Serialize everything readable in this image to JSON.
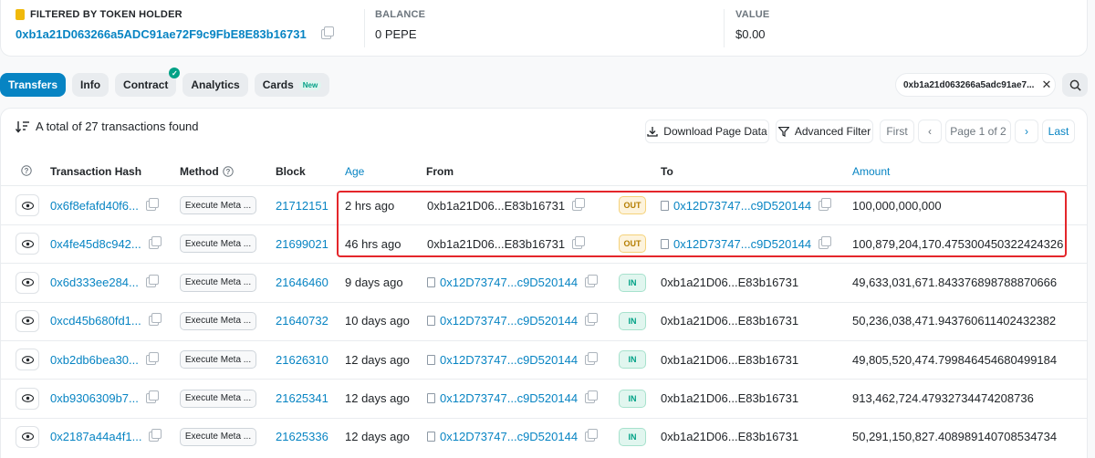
{
  "summary": {
    "holder_label": "FILTERED BY TOKEN HOLDER",
    "holder_address": "0xb1a21D063266a5ADC91ae72F9c9FbE8E83b16731",
    "balance_label": "BALANCE",
    "balance_value": "0 PEPE",
    "value_label": "VALUE",
    "value_value": "$0.00"
  },
  "tabs": [
    {
      "label": "Transfers",
      "active": true
    },
    {
      "label": "Info"
    },
    {
      "label": "Contract",
      "verified": true
    },
    {
      "label": "Analytics"
    },
    {
      "label": "Cards",
      "badge": "New"
    }
  ],
  "filter_chip": "0xb1a21d063266a5adc91ae7...",
  "table": {
    "total_text": "A total of 27 transactions found",
    "download_label": "Download Page Data",
    "advanced_filter_label": "Advanced Filter",
    "first_label": "First",
    "page_label": "Page 1 of 2",
    "last_label": "Last",
    "columns": {
      "hash": "Transaction Hash",
      "method": "Method",
      "block": "Block",
      "age": "Age",
      "from": "From",
      "to": "To",
      "amount": "Amount"
    },
    "rows": [
      {
        "hash": "0x6f8efafd40f6...",
        "method": "Execute Meta ...",
        "block": "21712151",
        "age": "2 hrs ago",
        "from": "0xb1a21D06...E83b16731",
        "dir": "OUT",
        "to": "0x12D73747...c9D520144",
        "amount": "100,000,000,000"
      },
      {
        "hash": "0x4fe45d8c942...",
        "method": "Execute Meta ...",
        "block": "21699021",
        "age": "46 hrs ago",
        "from": "0xb1a21D06...E83b16731",
        "dir": "OUT",
        "to": "0x12D73747...c9D520144",
        "amount": "100,879,204,170.475300450322424326"
      },
      {
        "hash": "0x6d333ee284...",
        "method": "Execute Meta ...",
        "block": "21646460",
        "age": "9 days ago",
        "from": "0x12D73747...c9D520144",
        "dir": "IN",
        "to": "0xb1a21D06...E83b16731",
        "amount": "49,633,031,671.843376898788870666"
      },
      {
        "hash": "0xcd45b680fd1...",
        "method": "Execute Meta ...",
        "block": "21640732",
        "age": "10 days ago",
        "from": "0x12D73747...c9D520144",
        "dir": "IN",
        "to": "0xb1a21D06...E83b16731",
        "amount": "50,236,038,471.943760611402432382"
      },
      {
        "hash": "0xb2db6bea30...",
        "method": "Execute Meta ...",
        "block": "21626310",
        "age": "12 days ago",
        "from": "0x12D73747...c9D520144",
        "dir": "IN",
        "to": "0xb1a21D06...E83b16731",
        "amount": "49,805,520,474.799846454680499184"
      },
      {
        "hash": "0xb9306309b7...",
        "method": "Execute Meta ...",
        "block": "21625341",
        "age": "12 days ago",
        "from": "0x12D73747...c9D520144",
        "dir": "IN",
        "to": "0xb1a21D06...E83b16731",
        "amount": "913,462,724.47932734474208736"
      },
      {
        "hash": "0x2187a44a4f1...",
        "method": "Execute Meta ...",
        "block": "21625336",
        "age": "12 days ago",
        "from": "0x12D73747...c9D520144",
        "dir": "IN",
        "to": "0xb1a21D06...E83b16731",
        "amount": "50,291,150,827.408989140708534734"
      }
    ]
  },
  "colors": {
    "accent": "#0784c3",
    "highlight": "#e4262b",
    "out": "#b47d00",
    "in": "#00a186"
  }
}
